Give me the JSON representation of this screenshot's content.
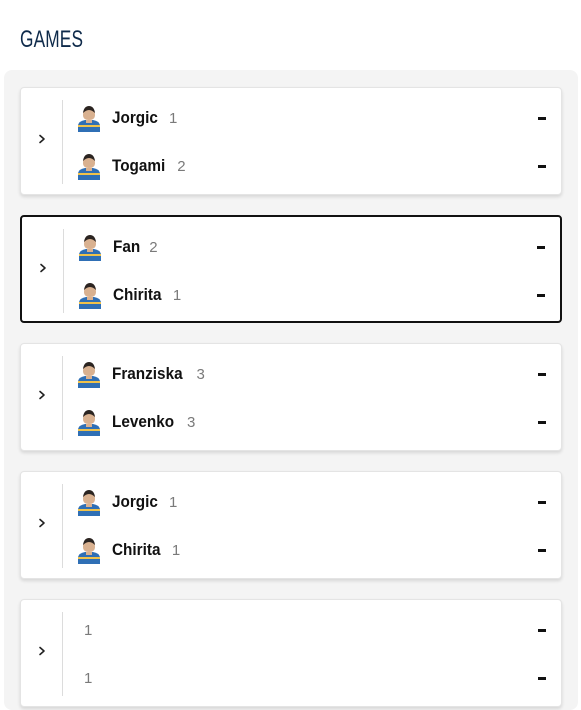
{
  "page": {
    "title": "GAMES"
  },
  "games": [
    {
      "selected": false,
      "players": [
        {
          "name": "Jorgic",
          "seed": "1",
          "score": "-",
          "avatar": "player-avatar"
        },
        {
          "name": "Togami",
          "seed": "2",
          "score": "-",
          "avatar": "player-avatar"
        }
      ]
    },
    {
      "selected": true,
      "players": [
        {
          "name": "Fan",
          "seed": "2",
          "score": "-",
          "avatar": "player-avatar"
        },
        {
          "name": "Chirita",
          "seed": "1",
          "score": "-",
          "avatar": "player-avatar"
        }
      ]
    },
    {
      "selected": false,
      "players": [
        {
          "name": "Franziska",
          "seed": "3",
          "score": "-",
          "avatar": "player-avatar"
        },
        {
          "name": "Levenko",
          "seed": "3",
          "score": "-",
          "avatar": "player-avatar"
        }
      ]
    },
    {
      "selected": false,
      "players": [
        {
          "name": "Jorgic",
          "seed": "1",
          "score": "-",
          "avatar": "player-avatar"
        },
        {
          "name": "Chirita",
          "seed": "1",
          "score": "-",
          "avatar": "player-avatar"
        }
      ]
    },
    {
      "selected": false,
      "players": [
        {
          "name": "",
          "seed": "1",
          "score": "-",
          "avatar": ""
        },
        {
          "name": "",
          "seed": "1",
          "score": "-",
          "avatar": ""
        }
      ]
    }
  ],
  "icons": {
    "expand": "chevron-right-icon",
    "avatar": "player-avatar"
  },
  "colors": {
    "title": "#0e2a4a",
    "jersey": "#2f6fb5",
    "selected_border": "#111111"
  }
}
